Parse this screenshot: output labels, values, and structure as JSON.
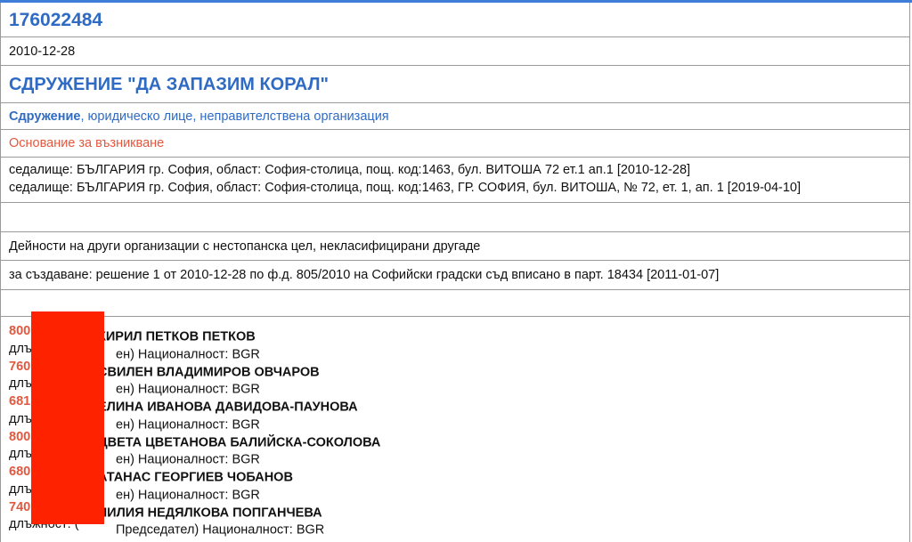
{
  "record": {
    "eik": "176022484",
    "date": "2010-12-28",
    "name": "СДРУЖЕНИЕ \"ДА ЗАПАЗИМ КОРАЛ\"",
    "type_strong": "Сдружение",
    "type_rest": ", юридическо лице, неправителствена организация",
    "basis": "Основание за възникване",
    "seats": [
      "седалище: БЪЛГАРИЯ гр. София, област: София-столица, пощ. код:1463, бул. ВИТОША 72 ет.1 ап.1 [2010-12-28]",
      "седалище: БЪЛГАРИЯ гр. София, област: София-столица, пощ. код:1463, ГР. СОФИЯ, бул. ВИТОША, № 72, ет. 1, ап. 1 [2019-04-10]"
    ],
    "activity": "Дейности на други организации с нестопанска цел, некласифицирани другаде",
    "creation": "за създаване: решение 1 от 2010-12-28 по ф.д. 805/2010 на Софийски градски съд вписано в парт. 18434 [2011-01-07]"
  },
  "people": [
    {
      "id": "800",
      "name": "КИРИЛ ПЕТКОВ ПЕТКОВ",
      "role_prefix": "длъжност: (Чл",
      "role_suffix": "ен) Националност: BGR"
    },
    {
      "id": "760",
      "name": "СВИЛЕН ВЛАДИМИРОВ ОВЧАРОВ",
      "role_prefix": "длъжност: (Чл",
      "role_suffix": "ен) Националност: BGR"
    },
    {
      "id": "681",
      "name": "ЕЛИНА ИВАНОВА ДАВИДОВА-ПАУНОВА",
      "role_prefix": "длъжност: (Чл",
      "role_suffix": "ен) Националност: BGR"
    },
    {
      "id": "800",
      "name": "ЦВЕТА ЦВЕТАНОВА БАЛИЙСКА-СОКОЛОВА",
      "role_prefix": "длъжност: (Чл",
      "role_suffix": "ен) Националност: BGR"
    },
    {
      "id": "680",
      "name": "АТАНАС ГЕОРГИЕВ ЧОБАНОВ",
      "role_prefix": "длъжност: (Чл",
      "role_suffix": "ен) Националност: BGR"
    },
    {
      "id": "740",
      "name": "ЛИЛИЯ НЕДЯЛКОВА ПОПГАНЧЕВА",
      "role_prefix": "длъжност: (",
      "role_suffix": "Председател) Националност: BGR"
    }
  ],
  "colors": {
    "accent_blue": "#2f6bc4",
    "accent_red": "#e3573f",
    "redaction": "#ff2200"
  }
}
